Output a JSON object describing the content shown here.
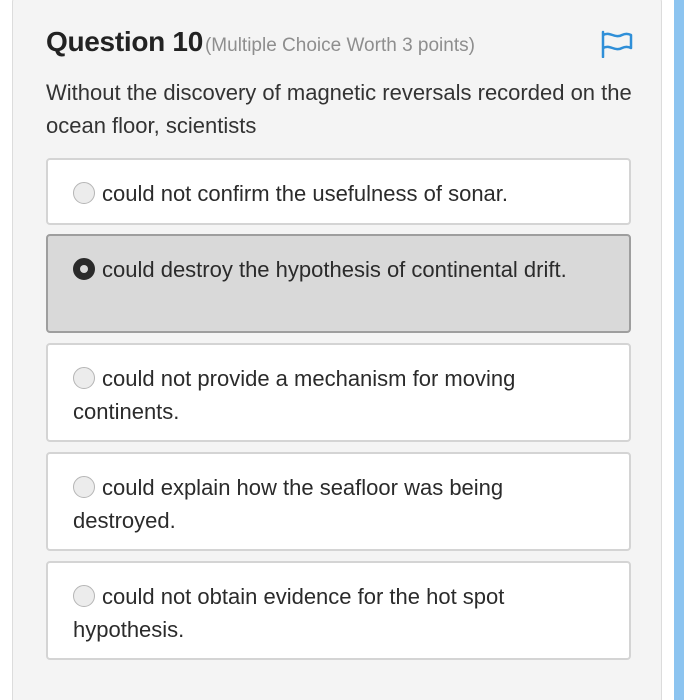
{
  "question": {
    "title": "Question 10",
    "subtitle": "(Multiple Choice Worth 3 points)",
    "text": "Without the discovery of magnetic reversals recorded on the ocean floor, scientists"
  },
  "options": [
    {
      "label": "could not confirm the usefulness of sonar.",
      "selected": false
    },
    {
      "label": "could destroy the hypothesis of continental drift.",
      "selected": true
    },
    {
      "label": "could not provide a mechanism for moving continents.",
      "selected": false
    },
    {
      "label": "could explain how the seafloor was being destroyed.",
      "selected": false
    },
    {
      "label": "could not obtain evidence for the hot spot hypothesis.",
      "selected": false
    }
  ],
  "icons": {
    "flag": "flag-icon",
    "radio": "radio-icon"
  },
  "colors": {
    "accent": "#2f8fd8",
    "scrollbar": "#8cc4f0"
  }
}
